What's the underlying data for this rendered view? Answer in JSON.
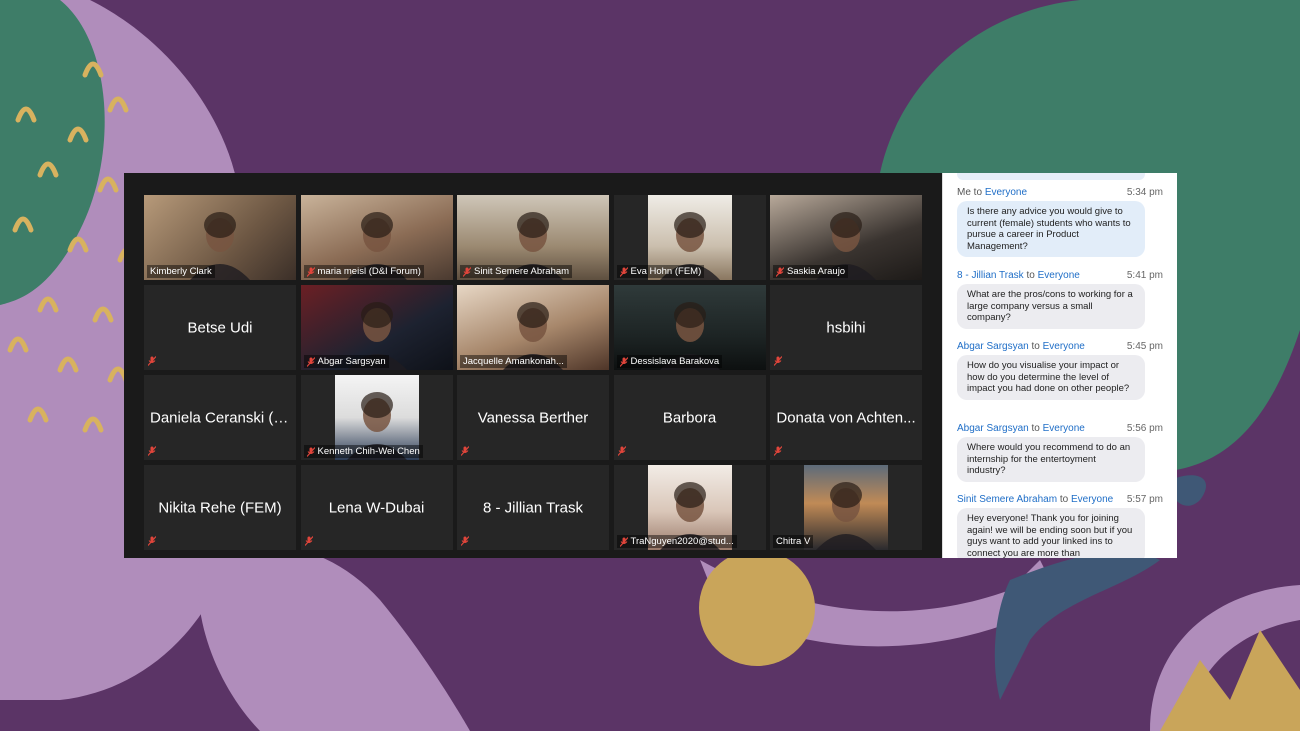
{
  "colors": {
    "background": "#5b3466",
    "accent_active": "#d7e37a",
    "chat_link": "#1f6ec7"
  },
  "tiles": [
    {
      "label": "Kimberly Clark",
      "video": true,
      "muted": false
    },
    {
      "label": "maria meisl (D&I Forum)",
      "video": true,
      "muted": true
    },
    {
      "label": "Sinit Semere Abraham",
      "video": true,
      "muted": true
    },
    {
      "label": "Eva Hohn (FEM)",
      "video": true,
      "muted": true
    },
    {
      "label": "Saskia Araujo",
      "video": true,
      "muted": true
    },
    {
      "label": "Betse Udi",
      "video": false,
      "muted": true
    },
    {
      "label": "Abgar Sargsyan",
      "video": true,
      "muted": true
    },
    {
      "label": "Jacquelle Amankonah...",
      "video": true,
      "muted": false,
      "active": true
    },
    {
      "label": "Dessislava Barakova",
      "video": true,
      "muted": true
    },
    {
      "label": "hsbihi",
      "video": false,
      "muted": true
    },
    {
      "label": "Daniela Ceranski (F...",
      "video": false,
      "muted": true
    },
    {
      "label": "Kenneth Chih-Wei Chen",
      "video": true,
      "muted": true
    },
    {
      "label": "Vanessa Berther",
      "video": false,
      "muted": true
    },
    {
      "label": "Barbora",
      "video": false,
      "muted": true
    },
    {
      "label": "Donata von Achten...",
      "video": false,
      "muted": true
    },
    {
      "label": "Nikita Rehe (FEM)",
      "video": false,
      "muted": true
    },
    {
      "label": "Lena W-Dubai",
      "video": false,
      "muted": true
    },
    {
      "label": "8 - Jillian Trask",
      "video": false,
      "muted": true
    },
    {
      "label": "TraNguyen2020@stud...",
      "video": true,
      "muted": true
    },
    {
      "label": "Chitra V",
      "video": true,
      "muted": false
    }
  ],
  "chat": {
    "messages": [
      {
        "sender": "Me",
        "to": "to",
        "recipient": "Everyone",
        "time": "5:34 pm",
        "text": "Is there any advice you would give to current (female) students who wants to pursue a career in Product Management?",
        "mine": true
      },
      {
        "sender": "8 - Jillian Trask",
        "to": "to",
        "recipient": "Everyone",
        "time": "5:41 pm",
        "text": "What are the pros/cons to working for a large company versus a small company?",
        "mine": false
      },
      {
        "sender": "Abgar Sargsyan",
        "to": "to",
        "recipient": "Everyone",
        "time": "5:45 pm",
        "text": "How do you visualise your impact or how do you determine the level of impact you had done on other people?",
        "mine": false
      },
      {
        "sender": "Abgar Sargsyan",
        "to": "to",
        "recipient": "Everyone",
        "time": "5:56 pm",
        "text": "Where would you recommend to do an internship for the entertoyment industry?",
        "mine": false
      },
      {
        "sender": "Sinit Semere Abraham",
        "to": "to",
        "recipient": "Everyone",
        "time": "5:57 pm",
        "text": "Hey everyone! Thank you for joining again! we will be ending soon but if you guys want to add your linked ins to connect you are more than",
        "mine": false
      }
    ]
  }
}
